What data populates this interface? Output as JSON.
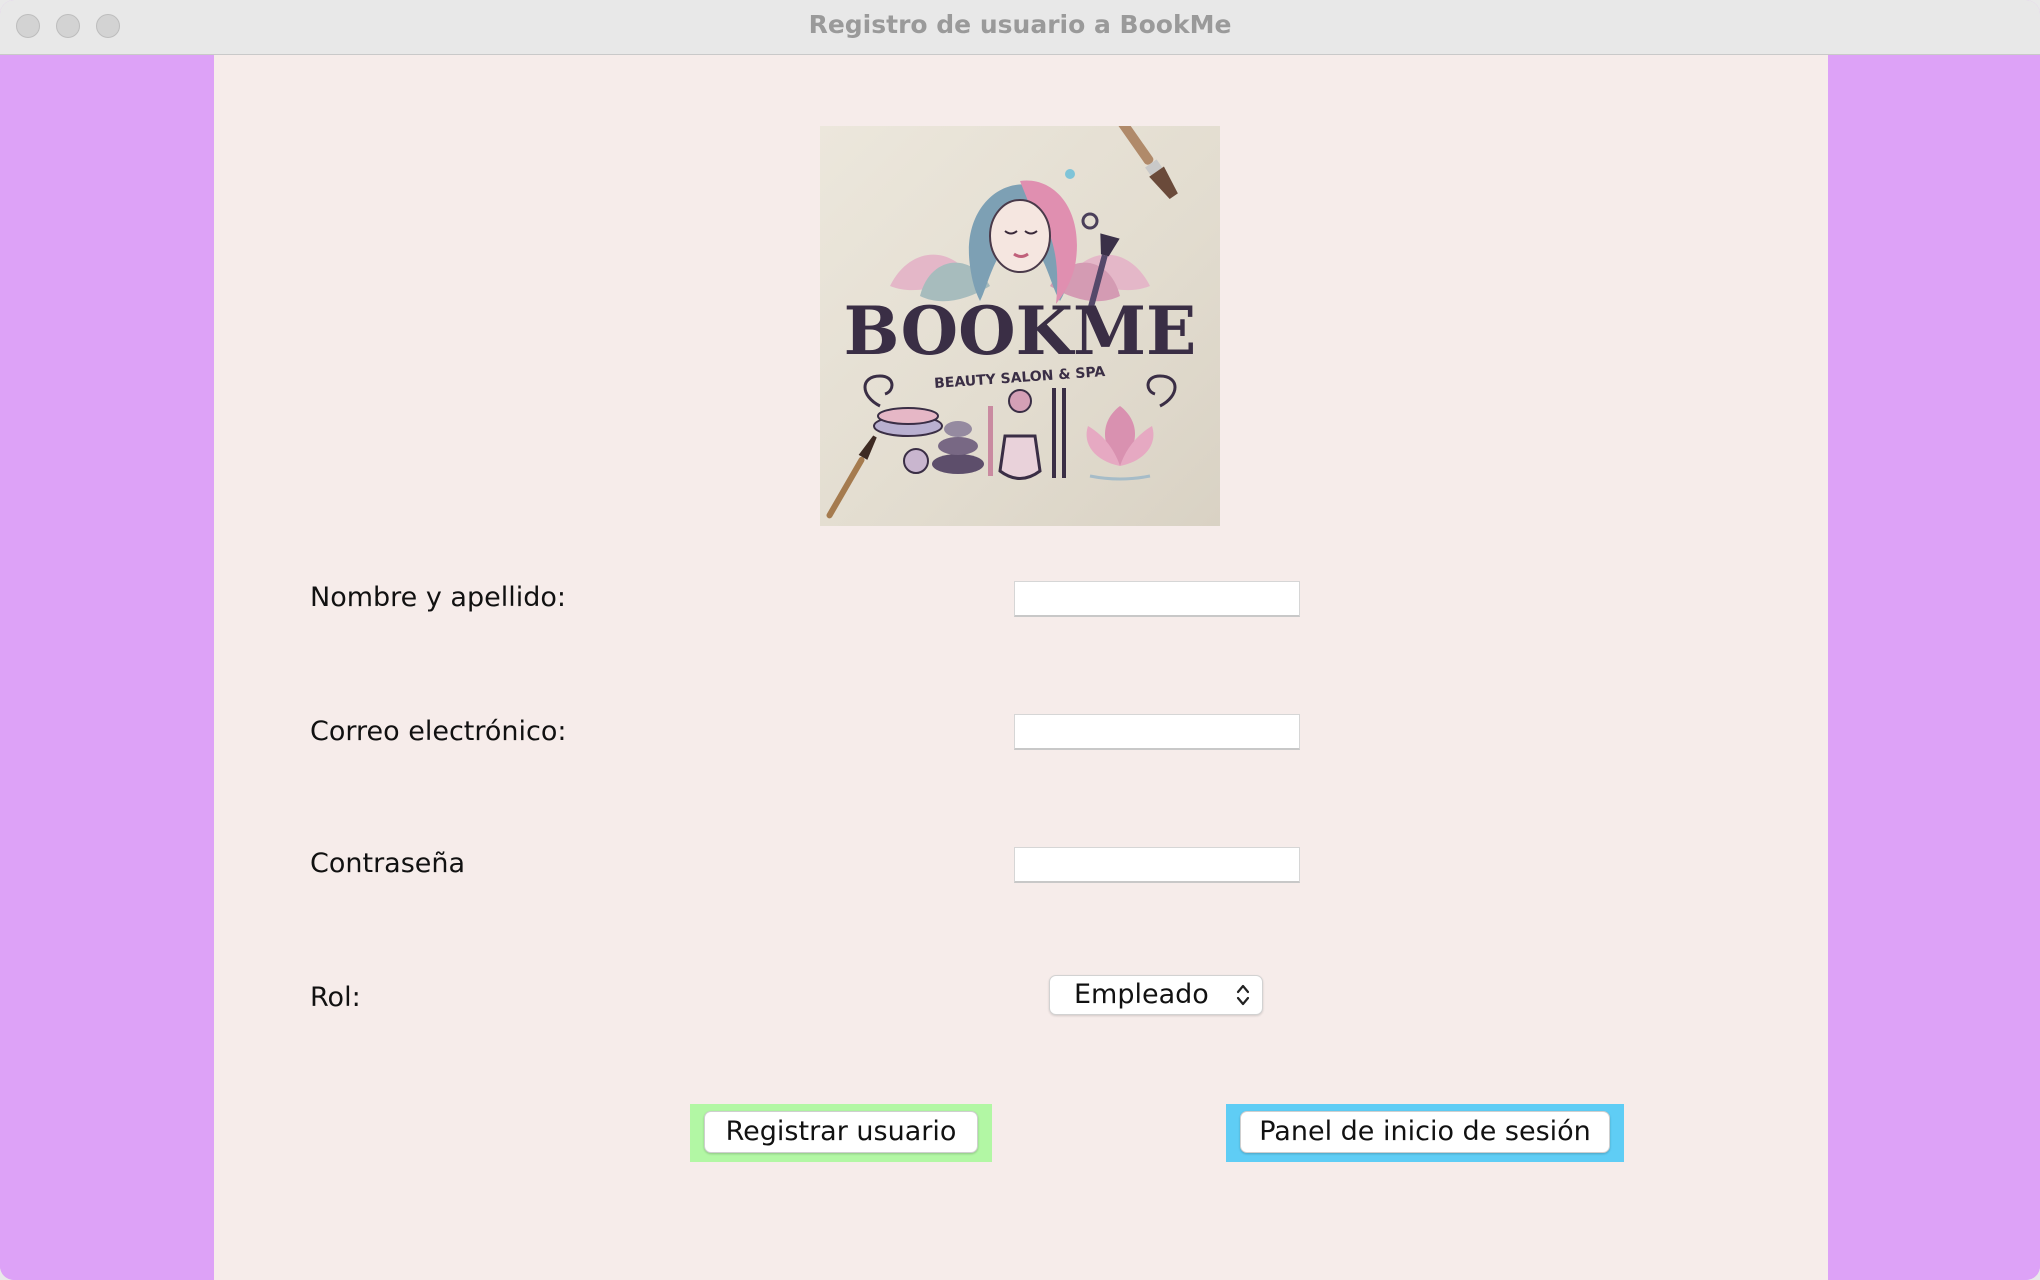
{
  "window": {
    "title": "Registro de usuario a BookMe"
  },
  "logo": {
    "brand_text": "BOOKME",
    "tagline": "BEAUTY SALON & SPA"
  },
  "form": {
    "name_label": "Nombre y apellido:",
    "name_value": "",
    "email_label": "Correo electrónico:",
    "email_value": "",
    "password_label": "Contraseña",
    "password_value": "",
    "role_label": "Rol:",
    "role_selected": "Empleado"
  },
  "buttons": {
    "register_label": "Registrar usuario",
    "login_panel_label": "Panel de inicio de sesión"
  },
  "colors": {
    "side_panel": "#dda2f7",
    "content_bg": "#f6ecea",
    "register_frame": "#b2f7a4",
    "login_frame": "#5fcdf5"
  }
}
